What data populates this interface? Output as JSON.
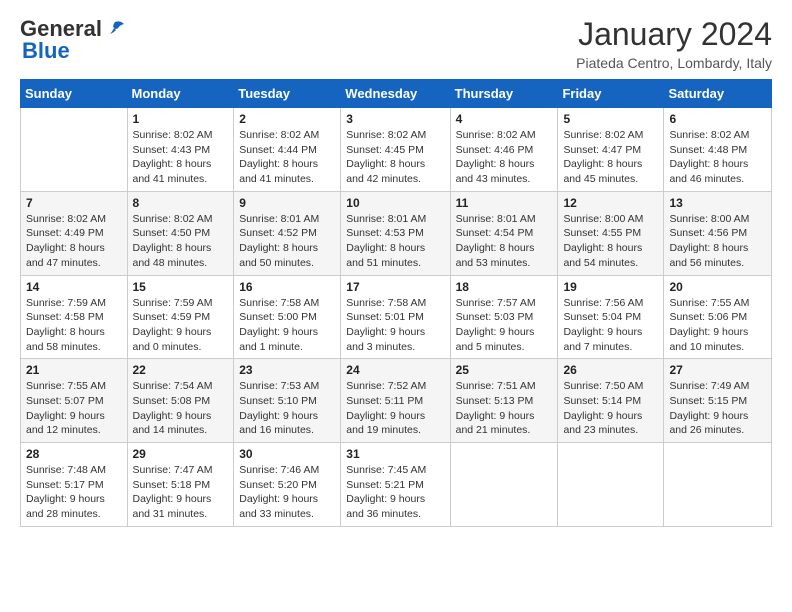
{
  "logo": {
    "general": "General",
    "blue": "Blue"
  },
  "header": {
    "title": "January 2024",
    "subtitle": "Piateda Centro, Lombardy, Italy"
  },
  "days_of_week": [
    "Sunday",
    "Monday",
    "Tuesday",
    "Wednesday",
    "Thursday",
    "Friday",
    "Saturday"
  ],
  "weeks": [
    [
      {
        "day": "",
        "info": ""
      },
      {
        "day": "1",
        "info": "Sunrise: 8:02 AM\nSunset: 4:43 PM\nDaylight: 8 hours\nand 41 minutes."
      },
      {
        "day": "2",
        "info": "Sunrise: 8:02 AM\nSunset: 4:44 PM\nDaylight: 8 hours\nand 41 minutes."
      },
      {
        "day": "3",
        "info": "Sunrise: 8:02 AM\nSunset: 4:45 PM\nDaylight: 8 hours\nand 42 minutes."
      },
      {
        "day": "4",
        "info": "Sunrise: 8:02 AM\nSunset: 4:46 PM\nDaylight: 8 hours\nand 43 minutes."
      },
      {
        "day": "5",
        "info": "Sunrise: 8:02 AM\nSunset: 4:47 PM\nDaylight: 8 hours\nand 45 minutes."
      },
      {
        "day": "6",
        "info": "Sunrise: 8:02 AM\nSunset: 4:48 PM\nDaylight: 8 hours\nand 46 minutes."
      }
    ],
    [
      {
        "day": "7",
        "info": "Sunrise: 8:02 AM\nSunset: 4:49 PM\nDaylight: 8 hours\nand 47 minutes."
      },
      {
        "day": "8",
        "info": "Sunrise: 8:02 AM\nSunset: 4:50 PM\nDaylight: 8 hours\nand 48 minutes."
      },
      {
        "day": "9",
        "info": "Sunrise: 8:01 AM\nSunset: 4:52 PM\nDaylight: 8 hours\nand 50 minutes."
      },
      {
        "day": "10",
        "info": "Sunrise: 8:01 AM\nSunset: 4:53 PM\nDaylight: 8 hours\nand 51 minutes."
      },
      {
        "day": "11",
        "info": "Sunrise: 8:01 AM\nSunset: 4:54 PM\nDaylight: 8 hours\nand 53 minutes."
      },
      {
        "day": "12",
        "info": "Sunrise: 8:00 AM\nSunset: 4:55 PM\nDaylight: 8 hours\nand 54 minutes."
      },
      {
        "day": "13",
        "info": "Sunrise: 8:00 AM\nSunset: 4:56 PM\nDaylight: 8 hours\nand 56 minutes."
      }
    ],
    [
      {
        "day": "14",
        "info": "Sunrise: 7:59 AM\nSunset: 4:58 PM\nDaylight: 8 hours\nand 58 minutes."
      },
      {
        "day": "15",
        "info": "Sunrise: 7:59 AM\nSunset: 4:59 PM\nDaylight: 9 hours\nand 0 minutes."
      },
      {
        "day": "16",
        "info": "Sunrise: 7:58 AM\nSunset: 5:00 PM\nDaylight: 9 hours\nand 1 minute."
      },
      {
        "day": "17",
        "info": "Sunrise: 7:58 AM\nSunset: 5:01 PM\nDaylight: 9 hours\nand 3 minutes."
      },
      {
        "day": "18",
        "info": "Sunrise: 7:57 AM\nSunset: 5:03 PM\nDaylight: 9 hours\nand 5 minutes."
      },
      {
        "day": "19",
        "info": "Sunrise: 7:56 AM\nSunset: 5:04 PM\nDaylight: 9 hours\nand 7 minutes."
      },
      {
        "day": "20",
        "info": "Sunrise: 7:55 AM\nSunset: 5:06 PM\nDaylight: 9 hours\nand 10 minutes."
      }
    ],
    [
      {
        "day": "21",
        "info": "Sunrise: 7:55 AM\nSunset: 5:07 PM\nDaylight: 9 hours\nand 12 minutes."
      },
      {
        "day": "22",
        "info": "Sunrise: 7:54 AM\nSunset: 5:08 PM\nDaylight: 9 hours\nand 14 minutes."
      },
      {
        "day": "23",
        "info": "Sunrise: 7:53 AM\nSunset: 5:10 PM\nDaylight: 9 hours\nand 16 minutes."
      },
      {
        "day": "24",
        "info": "Sunrise: 7:52 AM\nSunset: 5:11 PM\nDaylight: 9 hours\nand 19 minutes."
      },
      {
        "day": "25",
        "info": "Sunrise: 7:51 AM\nSunset: 5:13 PM\nDaylight: 9 hours\nand 21 minutes."
      },
      {
        "day": "26",
        "info": "Sunrise: 7:50 AM\nSunset: 5:14 PM\nDaylight: 9 hours\nand 23 minutes."
      },
      {
        "day": "27",
        "info": "Sunrise: 7:49 AM\nSunset: 5:15 PM\nDaylight: 9 hours\nand 26 minutes."
      }
    ],
    [
      {
        "day": "28",
        "info": "Sunrise: 7:48 AM\nSunset: 5:17 PM\nDaylight: 9 hours\nand 28 minutes."
      },
      {
        "day": "29",
        "info": "Sunrise: 7:47 AM\nSunset: 5:18 PM\nDaylight: 9 hours\nand 31 minutes."
      },
      {
        "day": "30",
        "info": "Sunrise: 7:46 AM\nSunset: 5:20 PM\nDaylight: 9 hours\nand 33 minutes."
      },
      {
        "day": "31",
        "info": "Sunrise: 7:45 AM\nSunset: 5:21 PM\nDaylight: 9 hours\nand 36 minutes."
      },
      {
        "day": "",
        "info": ""
      },
      {
        "day": "",
        "info": ""
      },
      {
        "day": "",
        "info": ""
      }
    ]
  ]
}
